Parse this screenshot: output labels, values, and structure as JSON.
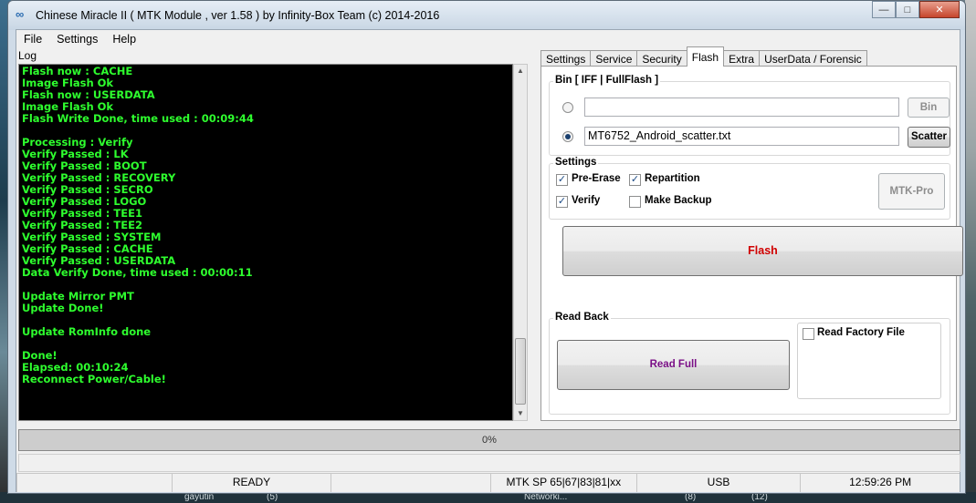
{
  "window": {
    "title": "Chinese Miracle II ( MTK Module , ver 1.58 ) by Infinity-Box Team (c) 2014-2016",
    "controls": {
      "minimize": "—",
      "maximize": "□",
      "close": "✕"
    }
  },
  "menu": [
    "File",
    "Settings",
    "Help"
  ],
  "log": {
    "label": "Log",
    "lines": [
      "Flash now : CACHE",
      "Image Flash Ok",
      "Flash now : USERDATA",
      "Image Flash Ok",
      "Flash Write Done, time used : 00:09:44",
      "",
      "Processing : Verify",
      "Verify Passed : LK",
      "Verify Passed : BOOT",
      "Verify Passed : RECOVERY",
      "Verify Passed : SECRO",
      "Verify Passed : LOGO",
      "Verify Passed : TEE1",
      "Verify Passed : TEE2",
      "Verify Passed : SYSTEM",
      "Verify Passed : CACHE",
      "Verify Passed : USERDATA",
      "Data Verify Done, time used : 00:00:11",
      "",
      "Update Mirror PMT",
      "Update Done!",
      "",
      "Update RomInfo done",
      "",
      "Done!",
      "Elapsed: 00:10:24",
      "Reconnect Power/Cable!"
    ]
  },
  "tabs": [
    "Settings",
    "Service",
    "Security",
    "Flash",
    "Extra",
    "UserData / Forensic"
  ],
  "active_tab": "Flash",
  "flash": {
    "bin_group": {
      "title": "Bin  [ IFF | FullFlash ]",
      "bin_value": "",
      "bin_button": "Bin",
      "scatter_value": "MT6752_Android_scatter.txt",
      "scatter_button": "Scatter",
      "selected": "scatter"
    },
    "settings_group": {
      "title": "Settings",
      "pre_erase": {
        "label": "Pre-Erase",
        "checked": true
      },
      "repartition": {
        "label": "Repartition",
        "checked": true
      },
      "verify": {
        "label": "Verify",
        "checked": true
      },
      "make_backup": {
        "label": "Make Backup",
        "checked": false
      },
      "mtk_pro_button": "MTK-Pro"
    },
    "flash_button": "Flash",
    "flash_button_color": "#d00000",
    "read_back": {
      "title": "Read Back",
      "read_full_button": "Read Full",
      "read_full_color": "#7a0f86",
      "read_factory_file": {
        "label": "Read Factory File",
        "checked": false
      }
    }
  },
  "progress": {
    "text": "0%",
    "value": 0
  },
  "status": {
    "state": "READY",
    "protocol": "MTK SP 65|67|83|81|xx",
    "connection": "USB",
    "time": "12:59:26 PM"
  },
  "taskbar": [
    "gayutin",
    "(5)",
    "Networki...",
    "(8)",
    "(12)"
  ]
}
